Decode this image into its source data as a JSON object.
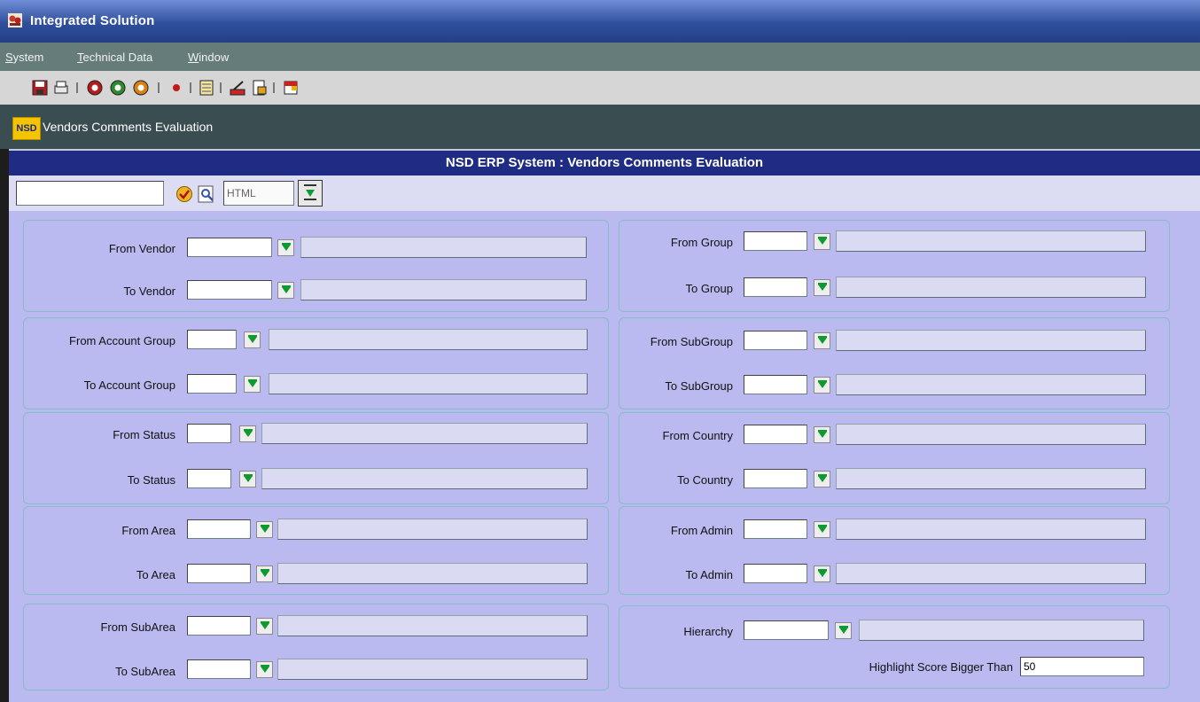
{
  "window": {
    "title": "Integrated Solution"
  },
  "menu": [
    "System",
    "Technical Data",
    "Window"
  ],
  "toolbar_icons": [
    "save-icon",
    "print-icon",
    "red-circle-icon",
    "green-circle-icon",
    "orange-circle-icon",
    "stop-icon",
    "grid-icon",
    "edit-icon",
    "document-icon",
    "exit-icon"
  ],
  "form": {
    "logo": "NSD",
    "title": "Vendors Comments Evaluation"
  },
  "header": {
    "title": "NSD ERP System : Vendors Comments Evaluation"
  },
  "search": {
    "value": "",
    "format": "HTML"
  },
  "left": {
    "from_vendor": "From Vendor",
    "to_vendor": "To Vendor",
    "from_account_group": "From Account Group",
    "to_account_group": "To Account Group",
    "from_status": "From Status",
    "to_status": "To  Status",
    "from_area": "From Area",
    "to_area": "To Area",
    "from_subarea": "From SubArea",
    "to_subarea": "To SubArea"
  },
  "right": {
    "from_group": "From Group",
    "to_group": "To Group",
    "from_subgroup": "From SubGroup",
    "to_subgroup": "To SubGroup",
    "from_country": "From Country",
    "to_country": "To Country",
    "from_admin": "From Admin",
    "to_admin": "To Admin",
    "hierarchy": "Hierarchy",
    "highlight_label": "Highlight Score Bigger Than",
    "highlight_value": "50"
  },
  "colors": {
    "title_bar": "#2f4f9c",
    "header_bar": "#1f2c83",
    "panel_bg": "#babaf0",
    "dropdown_arrow": "#0e9a2e"
  }
}
